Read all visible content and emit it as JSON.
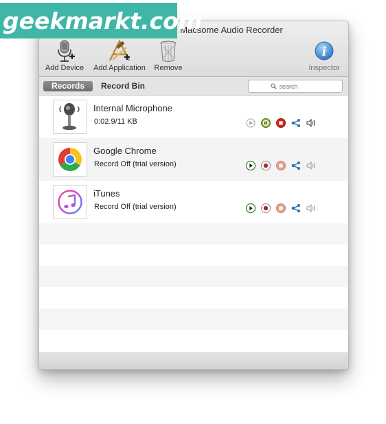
{
  "watermark": {
    "text": "geekmarkt.com"
  },
  "window": {
    "title": "Macsome Audio Recorder"
  },
  "toolbar": {
    "add_device": "Add Device",
    "add_application": "Add Application",
    "remove": "Remove",
    "inspector": "Inspector"
  },
  "tabs": {
    "records": "Records",
    "record_bin": "Record Bin"
  },
  "search": {
    "placeholder": "search"
  },
  "sources": [
    {
      "name": "Internal Microphone",
      "status": "0:02.9/11 KB",
      "icon": "microphone-icon",
      "recording": true
    },
    {
      "name": "Google Chrome",
      "status": "Record Off (trial version)",
      "icon": "chrome-icon",
      "recording": false
    },
    {
      "name": "iTunes",
      "status": "Record Off (trial version)",
      "icon": "itunes-icon",
      "recording": false
    }
  ],
  "colors": {
    "play": "#3a7d2a",
    "pause": "#7da81c",
    "stop_active": "#d8261f",
    "stop_inactive": "#e8a08c",
    "record": "#b52620",
    "share": "#2c6fb3"
  }
}
